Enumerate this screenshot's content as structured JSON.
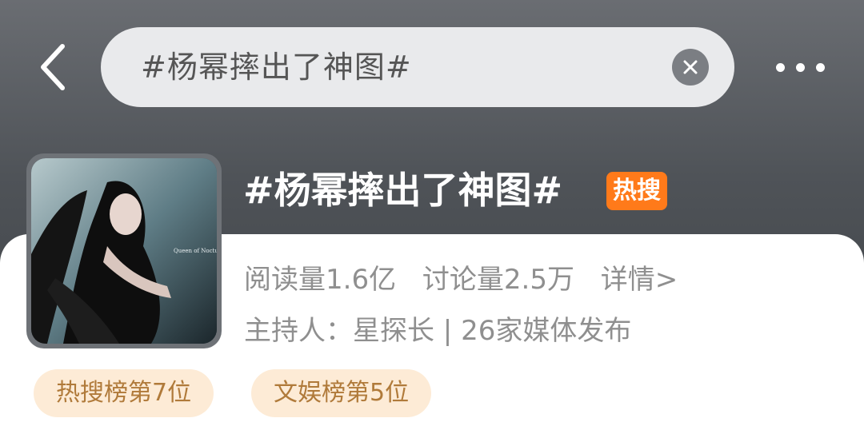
{
  "search": {
    "query": "#杨幂摔出了神图#"
  },
  "topic": {
    "title": "#杨幂摔出了神图#",
    "badge": "热搜",
    "reads": "阅读量1.6亿",
    "discussions": "讨论量2.5万",
    "details_link": "详情>",
    "host": "主持人：星探长 | 26家媒体发布"
  },
  "rank_tags": [
    {
      "label": "热搜榜第7位"
    },
    {
      "label": "文娱榜第5位"
    }
  ],
  "thumbnail": {
    "caption": "Queen of Nocturne"
  },
  "icons": {
    "back": "chevron-left-icon",
    "clear": "close-icon",
    "more": "more-horizontal-icon"
  },
  "colors": {
    "header_bg": "#55595e",
    "search_bg": "#e9eaec",
    "hot_badge": "#ff7a1a",
    "rank_tag_bg": "#fdebd6",
    "rank_tag_text": "#b07a3a",
    "muted_text": "#8f8f8f"
  }
}
